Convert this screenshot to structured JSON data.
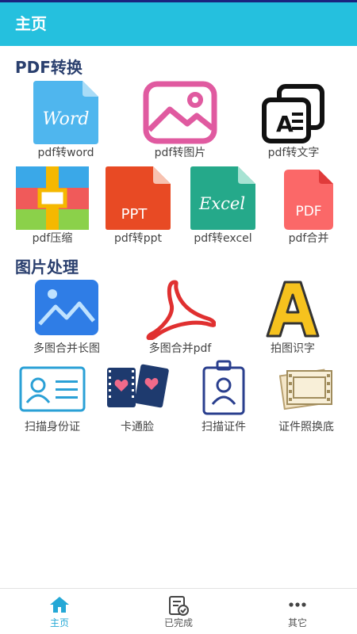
{
  "header": {
    "title": "主页"
  },
  "sections": {
    "pdf": {
      "title": "PDF转换",
      "items": [
        {
          "label": "pdf转word",
          "icon": "word-icon",
          "icon_text": "Word"
        },
        {
          "label": "pdf转图片",
          "icon": "image-icon"
        },
        {
          "label": "pdf转文字",
          "icon": "text-icon"
        },
        {
          "label": "pdf压缩",
          "icon": "compress-icon"
        },
        {
          "label": "pdf转ppt",
          "icon": "ppt-icon",
          "icon_text": "PPT"
        },
        {
          "label": "pdf转excel",
          "icon": "excel-icon",
          "icon_text": "Excel"
        },
        {
          "label": "pdf合并",
          "icon": "pdf-merge-icon",
          "icon_text": "PDF"
        }
      ]
    },
    "image": {
      "title": "图片处理",
      "items": [
        {
          "label": "多图合并长图",
          "icon": "long-image-icon"
        },
        {
          "label": "多图合并pdf",
          "icon": "acrobat-icon"
        },
        {
          "label": "拍图识字",
          "icon": "letter-a-icon"
        },
        {
          "label": "扫描身份证",
          "icon": "id-card-icon"
        },
        {
          "label": "卡通脸",
          "icon": "cartoon-cards-icon"
        },
        {
          "label": "扫描证件",
          "icon": "badge-icon"
        },
        {
          "label": "证件照换底",
          "icon": "film-photo-icon"
        }
      ]
    }
  },
  "bottom_nav": [
    {
      "label": "主页",
      "icon": "home-icon",
      "active": true
    },
    {
      "label": "已完成",
      "icon": "done-list-icon",
      "active": false
    },
    {
      "label": "其它",
      "icon": "more-icon",
      "active": false
    }
  ],
  "colors": {
    "header": "#25c0de",
    "accent": "#25a8d6",
    "section_title": "#2a3f6e"
  }
}
